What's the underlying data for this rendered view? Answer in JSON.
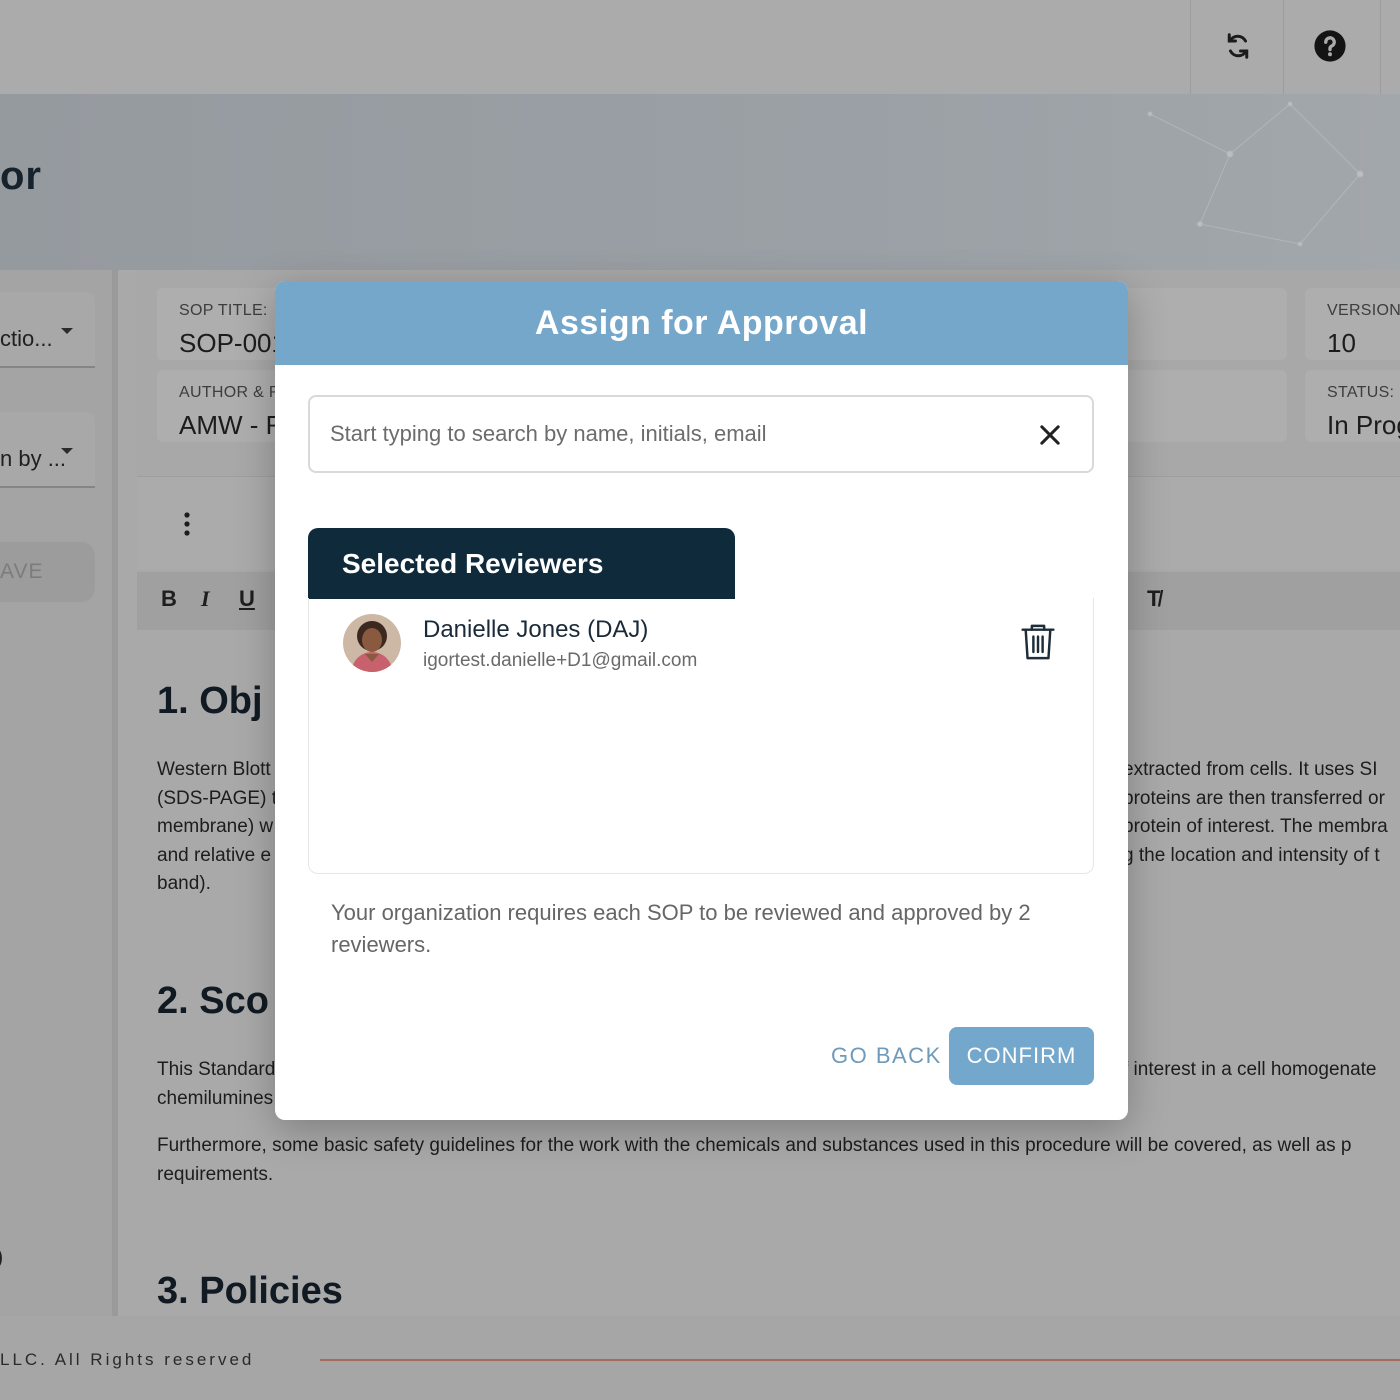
{
  "header": {
    "title_fragment": "or",
    "icons": [
      "sync-icon",
      "help-icon"
    ]
  },
  "left_panel": {
    "dropdown_1": "ctio...",
    "dropdown_2": "n by ...",
    "save_label": "AVE",
    "bottom_char": ")"
  },
  "sop_fields": {
    "title_label": "SOP TITLE:",
    "title_value": "SOP-001",
    "author_label": "AUTHOR & R",
    "author_value": "AMW - R",
    "version_label": "VERSION",
    "version_value": "10",
    "status_label": "STATUS:",
    "status_value": "In Prog"
  },
  "format_bar": {
    "bold": "B",
    "italic": "I",
    "underline": "U",
    "clear_format": "T̸"
  },
  "document": {
    "h1": "1.   Obj",
    "para1_left": [
      "Western Blott",
      "(SDS-PAGE) t",
      "membrane) w",
      "and relative e",
      "band)."
    ],
    "para1_right": [
      "extracted from cells. It uses SI",
      "proteins are then transferred or",
      "protein of interest. The membra",
      "g the location and intensity of t"
    ],
    "h2": "2.   Sco",
    "para2_left": [
      "This Standard",
      "chemilumines"
    ],
    "para2_right": "f interest in a cell homogenate",
    "para3": [
      "Furthermore, some basic safety guidelines for the work with the chemicals and substances used in this procedure will be covered, as well as p",
      "requirements."
    ],
    "h3": "3.   Policies"
  },
  "footer": {
    "copyright": "LLC. All Rights reserved"
  },
  "modal": {
    "title": "Assign for Approval",
    "search_placeholder": "Start typing to search by name, initials, email",
    "selected_tab": "Selected Reviewers",
    "reviewers": [
      {
        "name": "Danielle Jones (DAJ)",
        "email": "igortest.danielle+D1@gmail.com"
      }
    ],
    "note": "Your organization requires each SOP to be reviewed and approved by 2 reviewers.",
    "go_back_label": "GO BACK",
    "confirm_label": "CONFIRM"
  }
}
